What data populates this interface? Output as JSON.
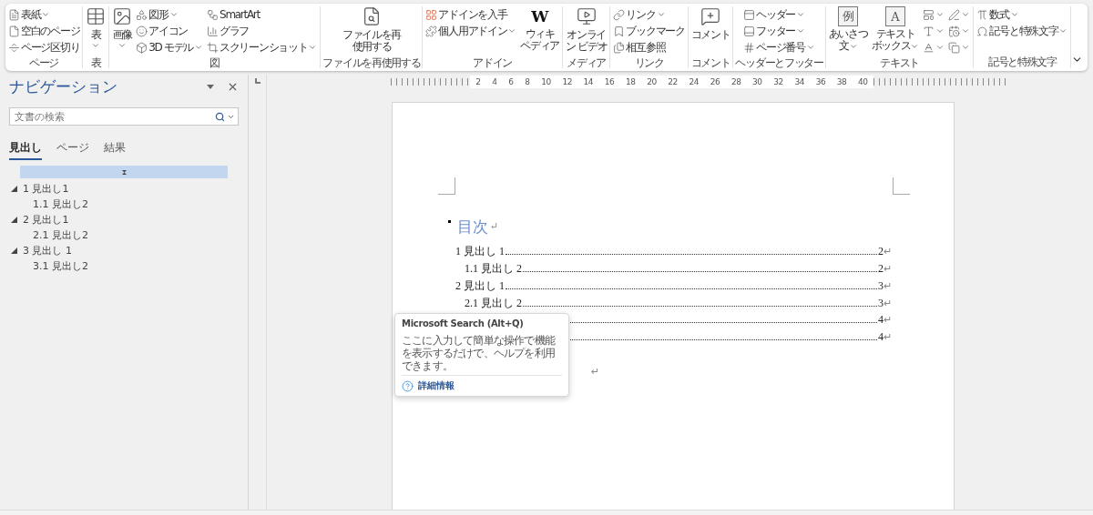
{
  "ribbon": {
    "groups": [
      {
        "label": "ページ",
        "columns": [
          {
            "kind": "stack",
            "items": [
              {
                "lines": [
                  "表紙"
                ],
                "dropdown": true
              },
              {
                "lines": [
                  "空白のページ"
                ],
                "dropdown": false
              },
              {
                "lines": [
                  "ページ区切り"
                ],
                "dropdown": false
              }
            ]
          }
        ]
      },
      {
        "label": "表",
        "columns": [
          {
            "kind": "large",
            "items": [
              {
                "lines": [
                  "表"
                ],
                "dropdown": true
              }
            ]
          }
        ]
      },
      {
        "label": "図",
        "columns": [
          {
            "kind": "large",
            "items": [
              {
                "lines": [
                  "画像"
                ],
                "dropdown": true
              }
            ]
          },
          {
            "kind": "stack",
            "items": [
              {
                "lines": [
                  "図形"
                ],
                "dropdown": true
              },
              {
                "lines": [
                  "アイコン"
                ],
                "dropdown": false
              },
              {
                "lines": [
                  "3D モデル"
                ],
                "dropdown": true
              }
            ]
          },
          {
            "kind": "stack",
            "items": [
              {
                "lines": [
                  "SmartArt"
                ],
                "dropdown": false
              },
              {
                "lines": [
                  "グラフ"
                ],
                "dropdown": false
              },
              {
                "lines": [
                  "スクリーンショット"
                ],
                "dropdown": true
              }
            ]
          }
        ]
      },
      {
        "label": "ファイルを再使用する",
        "columns": [
          {
            "kind": "large",
            "items": [
              {
                "lines": [
                  "ファイルを再",
                  "使用する"
                ],
                "dropdown": false
              }
            ]
          }
        ]
      },
      {
        "label": "アドイン",
        "columns": [
          {
            "kind": "stack",
            "items": [
              {
                "lines": [
                  "アドインを入手"
                ],
                "dropdown": false
              },
              {
                "lines": [
                  "個人用アドイン"
                ],
                "dropdown": true
              }
            ]
          },
          {
            "kind": "large",
            "items": [
              {
                "lines": [
                  "ウィキ",
                  "ペディア"
                ],
                "dropdown": false,
                "glyph": "W"
              }
            ]
          }
        ]
      },
      {
        "label": "メディア",
        "columns": [
          {
            "kind": "large",
            "items": [
              {
                "lines": [
                  "オンライ",
                  "ン ビデオ"
                ],
                "dropdown": false
              }
            ]
          }
        ]
      },
      {
        "label": "リンク",
        "columns": [
          {
            "kind": "stack",
            "items": [
              {
                "lines": [
                  "リンク"
                ],
                "dropdown": true
              },
              {
                "lines": [
                  "ブックマーク"
                ],
                "dropdown": false
              },
              {
                "lines": [
                  "相互参照"
                ],
                "dropdown": false
              }
            ]
          }
        ]
      },
      {
        "label": "コメント",
        "columns": [
          {
            "kind": "large",
            "items": [
              {
                "lines": [
                  "コメント"
                ],
                "dropdown": false
              }
            ]
          }
        ]
      },
      {
        "label": "ヘッダーとフッター",
        "columns": [
          {
            "kind": "stack",
            "items": [
              {
                "lines": [
                  "ヘッダー"
                ],
                "dropdown": true
              },
              {
                "lines": [
                  "フッター"
                ],
                "dropdown": true
              },
              {
                "lines": [
                  "ページ番号"
                ],
                "dropdown": true
              }
            ]
          }
        ]
      },
      {
        "label": "テキスト",
        "columns": [
          {
            "kind": "large",
            "items": [
              {
                "lines": [
                  "あいさつ",
                  "文"
                ],
                "dropdown": true,
                "glyph": "例"
              }
            ]
          },
          {
            "kind": "large",
            "items": [
              {
                "lines": [
                  "テキスト",
                  "ボックス"
                ],
                "dropdown": true,
                "glyph": "A"
              }
            ]
          },
          {
            "kind": "stack",
            "items": [
              {
                "dropdown": true
              },
              {
                "dropdown": true
              },
              {
                "dropdown": true
              }
            ]
          },
          {
            "kind": "stack",
            "items": [
              {
                "dropdown": true
              },
              {
                "dropdown": true
              },
              {
                "dropdown": true
              }
            ]
          }
        ]
      },
      {
        "label": "記号と特殊文字",
        "columns": [
          {
            "kind": "stack",
            "items": [
              {
                "lines": [
                  "数式"
                ],
                "dropdown": true
              },
              {
                "lines": [
                  "記号と特殊文字"
                ],
                "dropdown": true
              }
            ]
          }
        ]
      }
    ]
  },
  "navigation": {
    "title": "ナビゲーション",
    "search": {
      "placeholder": "文書の検索"
    },
    "tabs": [
      {
        "label": "見出し",
        "selected": true
      },
      {
        "label": "ページ",
        "selected": false
      },
      {
        "label": "結果",
        "selected": false
      }
    ],
    "headings": [
      {
        "label": "1 見出し1",
        "expanded": true,
        "children": [
          {
            "label": "1.1 見出し2"
          }
        ]
      },
      {
        "label": "2 見出し1",
        "expanded": true,
        "children": [
          {
            "label": "2.1 見出し2"
          }
        ]
      },
      {
        "label": "3 見出し 1",
        "expanded": true,
        "children": [
          {
            "label": "3.1 見出し2"
          }
        ]
      }
    ]
  },
  "ruler": [
    "2",
    "4",
    "6",
    "8",
    "10",
    "12",
    "14",
    "16",
    "18",
    "20",
    "22",
    "24",
    "26",
    "28",
    "30",
    "32",
    "34",
    "36",
    "38",
    "40"
  ],
  "document": {
    "heading": "目次",
    "mark": "↵",
    "toc": [
      {
        "label": "1  見出し 1",
        "page": "2",
        "children": [
          {
            "label": "1.1  見出し 2",
            "page": "2"
          }
        ]
      },
      {
        "label": "2  見出し 1",
        "page": "3",
        "children": [
          {
            "label": "2.1  見出し 2",
            "page": "3"
          }
        ]
      },
      {
        "page": "4",
        "children": [
          {
            "page": "4"
          }
        ]
      }
    ]
  },
  "tooltip": {
    "title": "Microsoft Search (Alt+Q)",
    "body": "ここに入力して簡単な操作で機能を表示するだけで、ヘルプを利用できます。",
    "link": "詳細情報"
  }
}
